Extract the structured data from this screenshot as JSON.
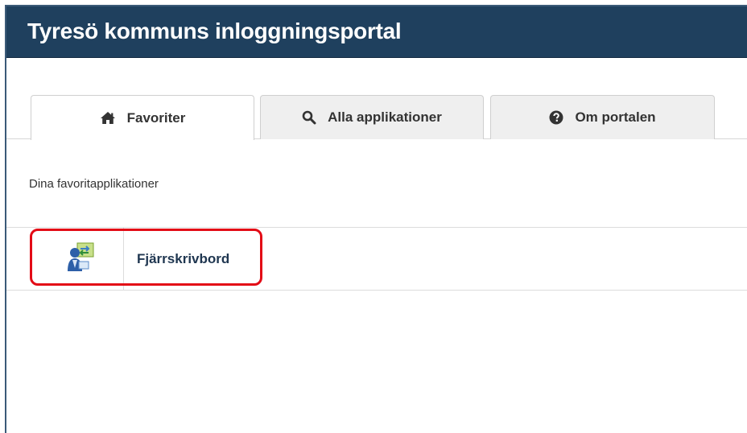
{
  "header": {
    "title": "Tyresö kommuns inloggningsportal"
  },
  "tabs": [
    {
      "label": "Favoriter",
      "icon": "home-icon",
      "active": true
    },
    {
      "label": "Alla applikationer",
      "icon": "search-icon",
      "active": false
    },
    {
      "label": "Om portalen",
      "icon": "question-circle-icon",
      "active": false
    }
  ],
  "favorites": {
    "heading": "Dina favoritapplikationer",
    "apps": [
      {
        "label": "Fjärrskrivbord",
        "icon": "remote-desktop-icon"
      }
    ]
  },
  "colors": {
    "header_bg": "#1f405e",
    "highlight": "#e30b16"
  }
}
